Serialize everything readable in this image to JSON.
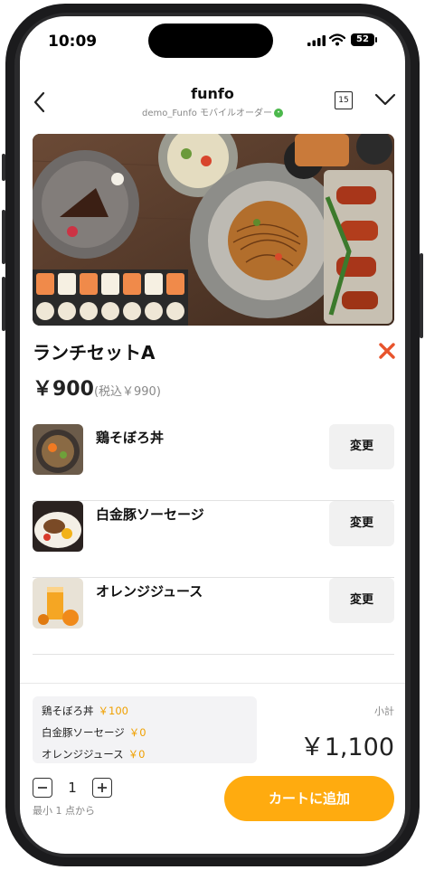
{
  "status_bar": {
    "time": "10:09",
    "battery": "52"
  },
  "header": {
    "title": "funfo",
    "subtitle": "demo_Funfo モバイルオーダー",
    "badge_icon": "line-badge-icon",
    "calendar_day": "15"
  },
  "item": {
    "name": "ランチセットA",
    "price": "￥900",
    "price_tax": "(税込￥990)"
  },
  "options": [
    {
      "name": "鶏そぼろ丼",
      "change_label": "変更"
    },
    {
      "name": "白金豚ソーセージ",
      "change_label": "変更"
    },
    {
      "name": "オレンジジュース",
      "change_label": "変更"
    }
  ],
  "summary": {
    "lines": [
      {
        "name": "鶏そぼろ丼",
        "price": "￥100"
      },
      {
        "name": "白金豚ソーセージ",
        "price": "￥0"
      },
      {
        "name": "オレンジジュース",
        "price": "￥0"
      }
    ],
    "subtotal_label": "小計",
    "subtotal": "￥1,100"
  },
  "quantity": {
    "value": "1",
    "min_note": "最小 1 点から"
  },
  "cart_button": "カートに追加",
  "colors": {
    "accent": "#ffab0f",
    "close_red": "#e8542c"
  }
}
